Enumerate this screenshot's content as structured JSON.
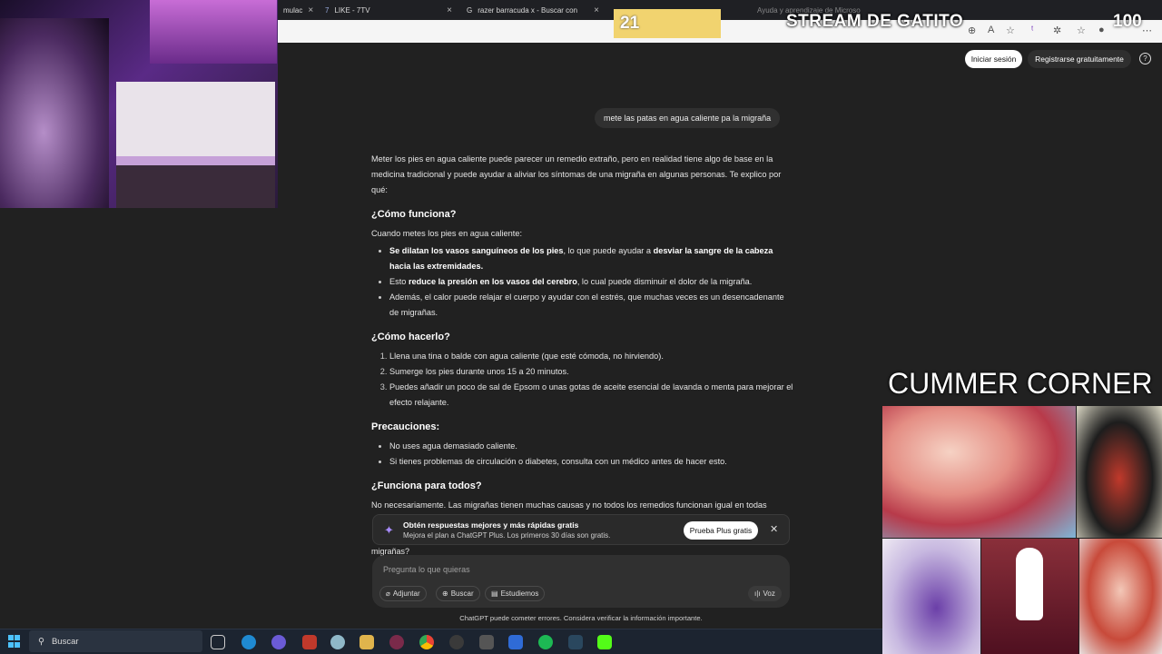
{
  "browser": {
    "tabs": [
      {
        "label": "mulac",
        "active": false
      },
      {
        "label": "LIKE - 7TV",
        "active": false
      },
      {
        "label": "razer barracuda x - Buscar con Go",
        "active": false
      },
      {
        "label": "Ayuda y aprendizaje de Microso",
        "active": false
      }
    ]
  },
  "header": {
    "login": "Iniciar sesión",
    "signup": "Registrarse gratuitamente",
    "help": "?"
  },
  "conversation": {
    "user_message": "mete las patas en agua caliente pa la migraña",
    "intro": "Meter los pies en agua caliente puede parecer un remedio extraño, pero en realidad tiene algo de base en la medicina tradicional y puede ayudar a aliviar los síntomas de una migraña en algunas personas. Te explico por qué:",
    "s1_title": "¿Cómo funciona?",
    "s1_lead": "Cuando metes los pies en agua caliente:",
    "s1_b1_a": "Se dilatan los vasos sanguíneos de los pies",
    "s1_b1_b": ", lo que puede ayudar a ",
    "s1_b1_c": "desviar la sangre de la cabeza hacia las extremidades.",
    "s1_b2_a": "Esto ",
    "s1_b2_b": "reduce la presión en los vasos del cerebro",
    "s1_b2_c": ", lo cual puede disminuir el dolor de la migraña.",
    "s1_b3": "Además, el calor puede relajar el cuerpo y ayudar con el estrés, que muchas veces es un desencadenante de migrañas.",
    "s2_title": "¿Cómo hacerlo?",
    "s2_steps": [
      "Llena una tina o balde con agua caliente (que esté cómoda, no hirviendo).",
      "Sumerge los pies durante unos 15 a 20 minutos.",
      "Puedes añadir un poco de sal de Epsom o unas gotas de aceite esencial de lavanda o menta para mejorar el efecto relajante."
    ],
    "s3_title": "Precauciones:",
    "s3_items": [
      "No uses agua demasiado caliente.",
      "Si tienes problemas de circulación o diabetes, consulta con un médico antes de hacer esto."
    ],
    "s4_title": "¿Funciona para todos?",
    "s4_text": "No necesariamente. Las migrañas tienen muchas causas y no todos los remedios funcionan igual en todas",
    "cut_text": "migrañas?"
  },
  "upsell": {
    "title": "Obtén respuestas mejores y más rápidas gratis",
    "subtitle": "Mejora el plan a ChatGPT Plus. Los primeros 30 días son gratis.",
    "button": "Prueba Plus gratis",
    "close": "✕"
  },
  "composer": {
    "placeholder": "Pregunta lo que quieras",
    "attach": "Adjuntar",
    "search": "Buscar",
    "study": "Estudiemos",
    "voice": "Voz"
  },
  "disclaimer": "ChatGPT puede cometer errores. Considera verificar la información importante.",
  "overlay": {
    "counter_left": "21",
    "stream_title": "STREAM DE GATITO",
    "counter_right": "100",
    "corner_title": "CUMMER CORNER"
  },
  "taskbar": {
    "search_label": "Buscar"
  },
  "colors": {
    "page_bg": "#212121",
    "accent_purple": "#a78bfa",
    "counter_yellow": "#f1d36f",
    "taskbar_bg": "#1c2430"
  }
}
